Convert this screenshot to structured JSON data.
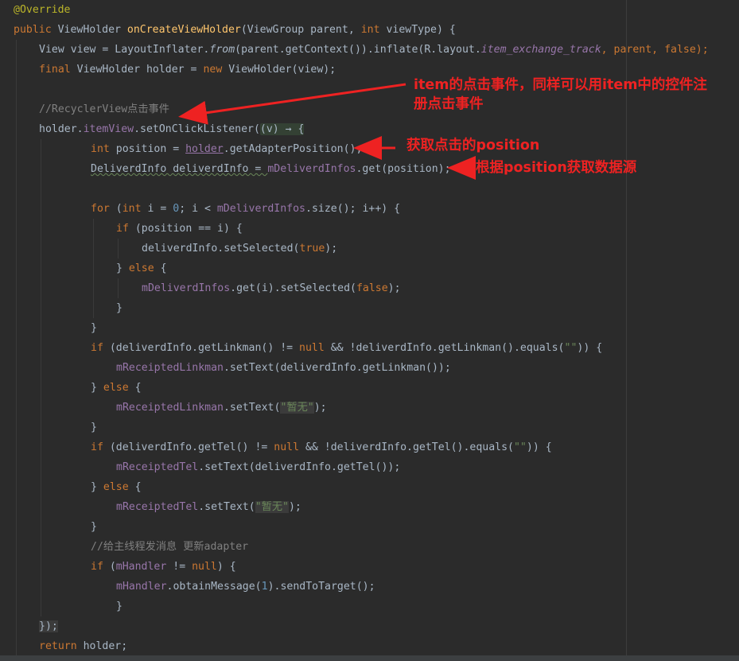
{
  "code": {
    "l1_ann": "@Override",
    "l2_public": "public",
    "l2_type": " ViewHolder ",
    "l2_method": "onCreateViewHolder",
    "l2_p1": "(ViewGroup parent, ",
    "l2_int": "int",
    "l2_p2": " viewType) {",
    "l3_a": "View view = LayoutInflater.",
    "l3_from": "from",
    "l3_b": "(parent.getContext()).inflate(R.layout.",
    "l3_layout": "item_exchange_track",
    "l3_c": ", parent, ",
    "l3_false": "false",
    "l3_d": ");",
    "l4_final": "final",
    "l4_a": " ViewHolder holder = ",
    "l4_new": "new",
    "l4_b": " ViewHolder(view);",
    "l6_comment": "//RecyclerView点击事件",
    "l7_a": "holder.",
    "l7_itemview": "itemView",
    "l7_b": ".setOnClickListener(",
    "l7_lambda": "(v) → {",
    "l8_int": "int",
    "l8_a": " position = ",
    "l8_holder": "holder",
    "l8_b": ".getAdapterPosition();",
    "l9_a": "DeliverdInfo deliverdInfo = ",
    "l9_field": "mDeliverdInfos",
    "l9_b": ".get(position);",
    "l11_for": "for",
    "l11_a": " (",
    "l11_int": "int",
    "l11_b": " i = ",
    "l11_zero": "0",
    "l11_c": "; i < ",
    "l11_field": "mDeliverdInfos",
    "l11_d": ".size(); i++) {",
    "l12_if": "if",
    "l12_a": " (position == i) {",
    "l13_a": "deliverdInfo.setSelected(",
    "l13_true": "true",
    "l13_b": ");",
    "l14_a": "} ",
    "l14_else": "else",
    "l14_b": " {",
    "l15_field": "mDeliverdInfos",
    "l15_a": ".get(i).setSelected(",
    "l15_false": "false",
    "l15_b": ");",
    "l16": "}",
    "l17": "}",
    "l18_if": "if",
    "l18_a": " (deliverdInfo.getLinkman() != ",
    "l18_null": "null",
    "l18_b": " && !deliverdInfo.getLinkman().equals(",
    "l18_str": "\"\"",
    "l18_c": ")) {",
    "l19_field": "mReceiptedLinkman",
    "l19_a": ".setText(deliverdInfo.getLinkman());",
    "l20_a": "} ",
    "l20_else": "else",
    "l20_b": " {",
    "l21_field": "mReceiptedLinkman",
    "l21_a": ".setText(",
    "l21_str": "\"暂无\"",
    "l21_b": ");",
    "l22": "}",
    "l23_if": "if",
    "l23_a": " (deliverdInfo.getTel() != ",
    "l23_null": "null",
    "l23_b": " && !deliverdInfo.getTel().equals(",
    "l23_str": "\"\"",
    "l23_c": ")) {",
    "l24_field": "mReceiptedTel",
    "l24_a": ".setText(deliverdInfo.getTel());",
    "l25_a": "} ",
    "l25_else": "else",
    "l25_b": " {",
    "l26_field": "mReceiptedTel",
    "l26_a": ".setText(",
    "l26_str": "\"暂无\"",
    "l26_b": ");",
    "l27": "}",
    "l28_comment": "//给主线程发消息 更新adapter",
    "l29_if": "if",
    "l29_a": " (",
    "l29_field": "mHandler",
    "l29_b": " != ",
    "l29_null": "null",
    "l29_c": ") {",
    "l30_field": "mHandler",
    "l30_a": ".obtainMessage(",
    "l30_one": "1",
    "l30_b": ").sendToTarget();",
    "l31": "}",
    "l32": "});",
    "l33_return": "return",
    "l33_a": " holder;"
  },
  "annotations": {
    "note1_line1": "item的点击事件，同样可以用item中的控件注",
    "note1_line2": "册点击事件",
    "note2": "获取点击的position",
    "note3": "根据position获取数据源"
  },
  "colors": {
    "background": "#2b2b2b",
    "keyword": "#cc7832",
    "annotation": "#bbb529",
    "number": "#6897bb",
    "string": "#6a8759",
    "field": "#9876aa",
    "method_decl": "#ffc66d",
    "comment": "#808080",
    "text": "#a9b7c6",
    "note": "#ee2222"
  }
}
